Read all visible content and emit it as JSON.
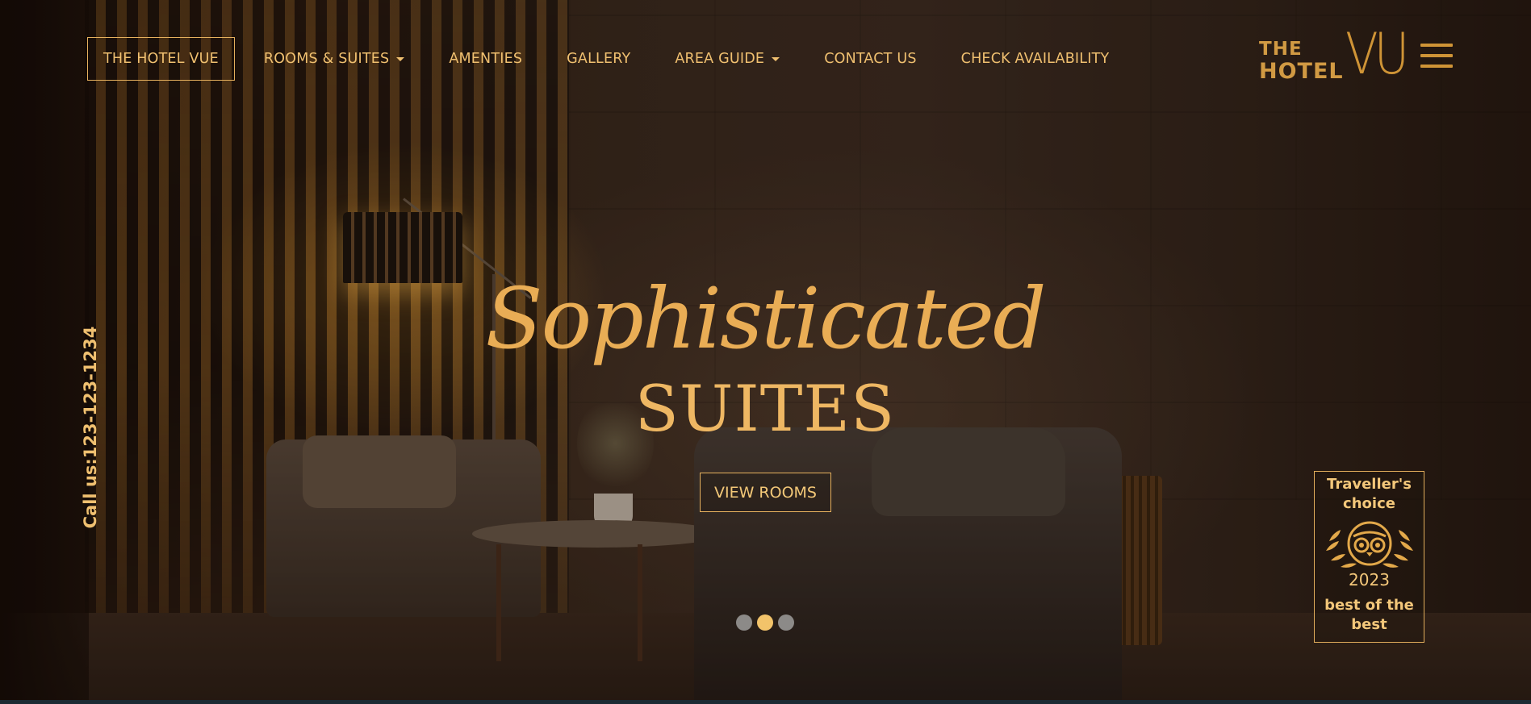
{
  "nav": {
    "items": [
      {
        "label": "THE HOTEL VUE",
        "active": true,
        "has_dropdown": false
      },
      {
        "label": "ROOMS & SUITES",
        "active": false,
        "has_dropdown": true
      },
      {
        "label": "AMENTIES",
        "active": false,
        "has_dropdown": false
      },
      {
        "label": "GALLERY",
        "active": false,
        "has_dropdown": false
      },
      {
        "label": "AREA GUIDE",
        "active": false,
        "has_dropdown": true
      },
      {
        "label": "CONTACT US",
        "active": false,
        "has_dropdown": false
      },
      {
        "label": "CHECK AVAILABILITY",
        "active": false,
        "has_dropdown": false
      }
    ]
  },
  "logo": {
    "the": "THE",
    "hotel": "HOTEL",
    "vue": "VU"
  },
  "call_us": "Call us:123-123-1234",
  "hero": {
    "script_title": "Sophisticated",
    "title": "SUITES",
    "cta_label": "VIEW ROOMS"
  },
  "carousel": {
    "slide_count": 3,
    "active_index": 1
  },
  "badge": {
    "title": "Traveller's choice",
    "year": "2023",
    "subtitle": "best of the best",
    "emblem": "tripadvisor-owl-laurel-icon"
  },
  "colors": {
    "accent": "#e6b15e",
    "text_gold": "#f0c070",
    "logo_gold": "#cf9436",
    "dot_inactive": "#8c8a88",
    "dot_active": "#f2c36a"
  }
}
